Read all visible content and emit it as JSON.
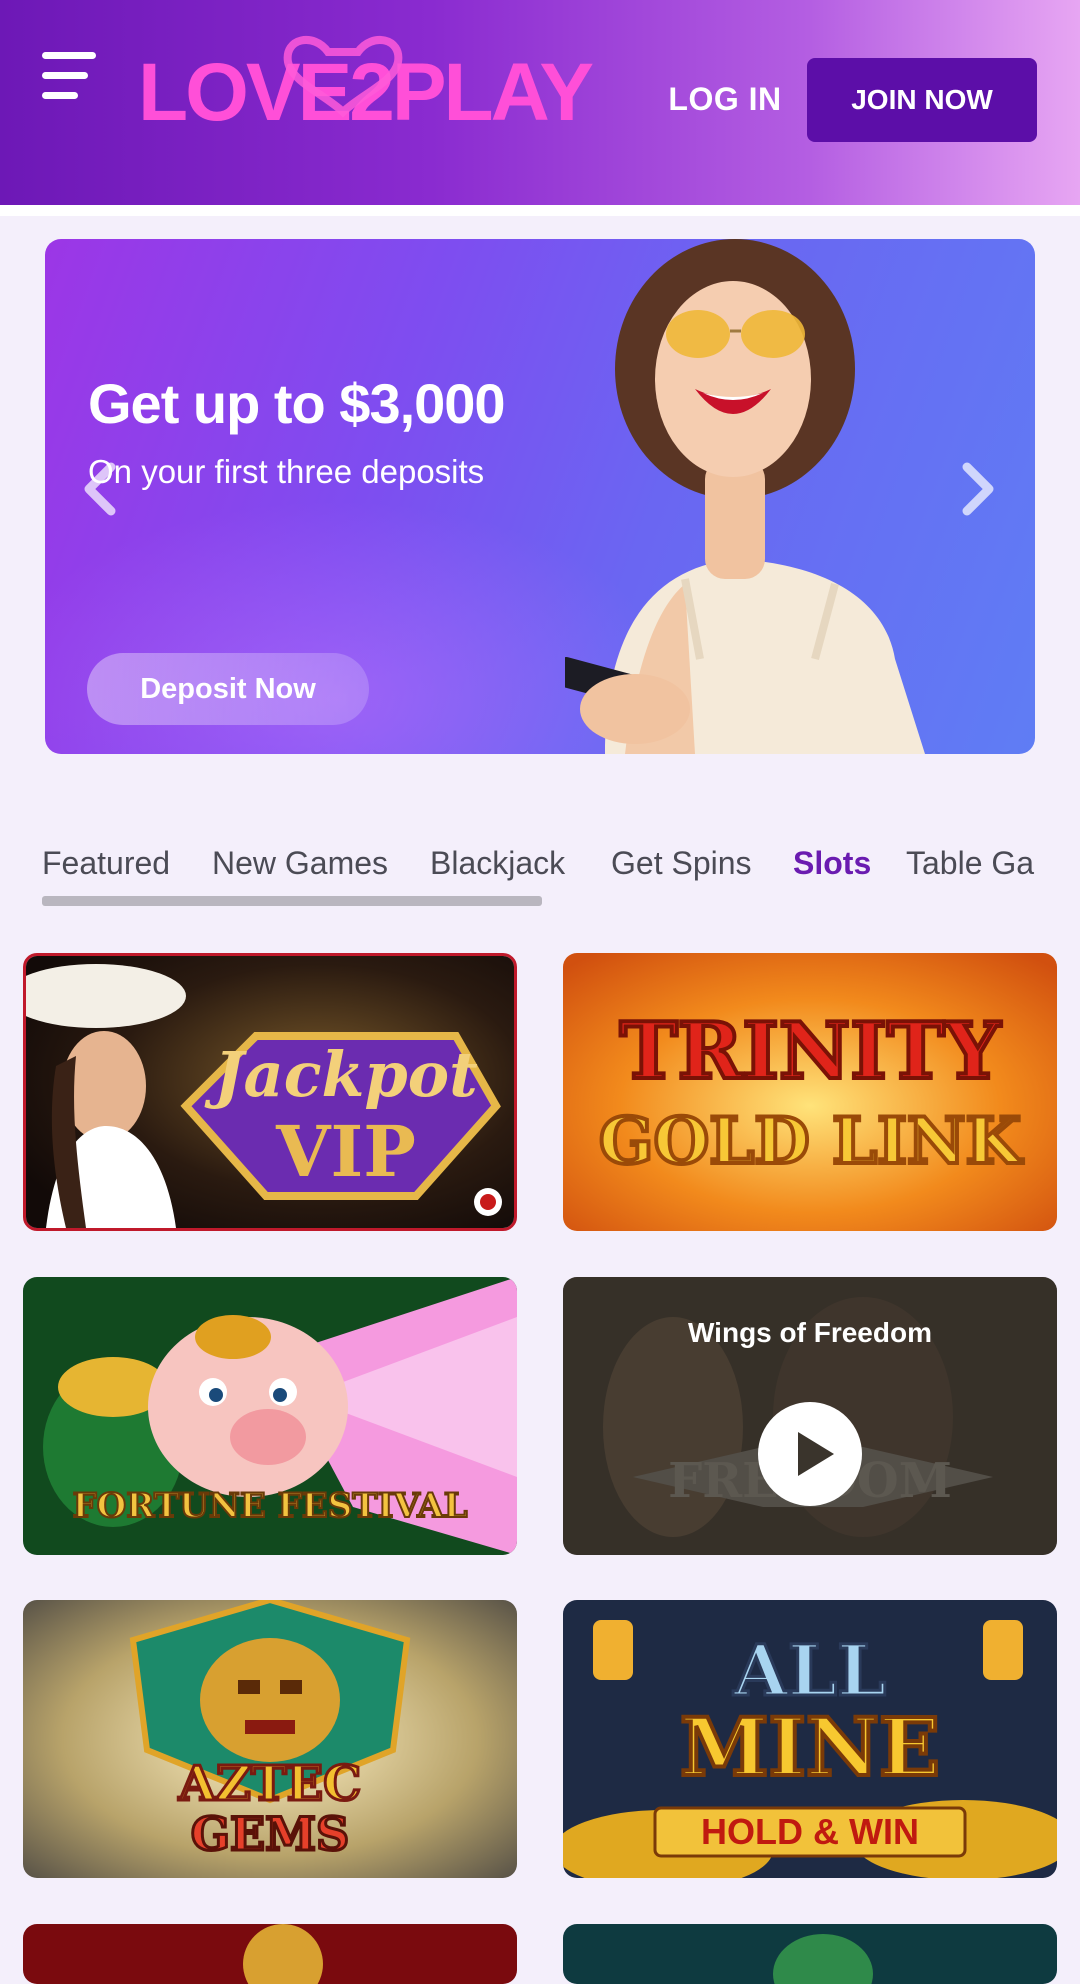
{
  "header": {
    "logo_text": "LOVE2PLAY",
    "login_label": "LOG IN",
    "join_label": "JOIN NOW"
  },
  "banner": {
    "title": "Get up to $3,000",
    "subtitle": "On your first three deposits",
    "cta_label": "Deposit Now"
  },
  "tabs": [
    {
      "label": "Featured"
    },
    {
      "label": "New Games"
    },
    {
      "label": "Blackjack"
    },
    {
      "label": "Get Spins"
    },
    {
      "label": "Slots"
    },
    {
      "label": "Table Ga"
    }
  ],
  "active_tab": "Slots",
  "games": [
    {
      "title_line1": "Jackpot",
      "title_line2": "VIP"
    },
    {
      "title_line1": "TRINITY",
      "title_line2": "GOLD LINK"
    },
    {
      "title_line1": "FORTUNE FESTIVAL"
    },
    {
      "overlay_title": "Wings of Freedom",
      "art_text": "FREEDOM"
    },
    {
      "title_line1": "AZTEC",
      "title_line2": "GEMS"
    },
    {
      "title_line1": "ALL",
      "title_line2": "MINE",
      "tagline": "HOLD & WIN"
    }
  ],
  "colors": {
    "brand_purple": "#5c0ea8",
    "active_tab": "#6a1bb0",
    "header_gradient_start": "#6d18b6",
    "header_gradient_end": "#e7a6f3"
  }
}
